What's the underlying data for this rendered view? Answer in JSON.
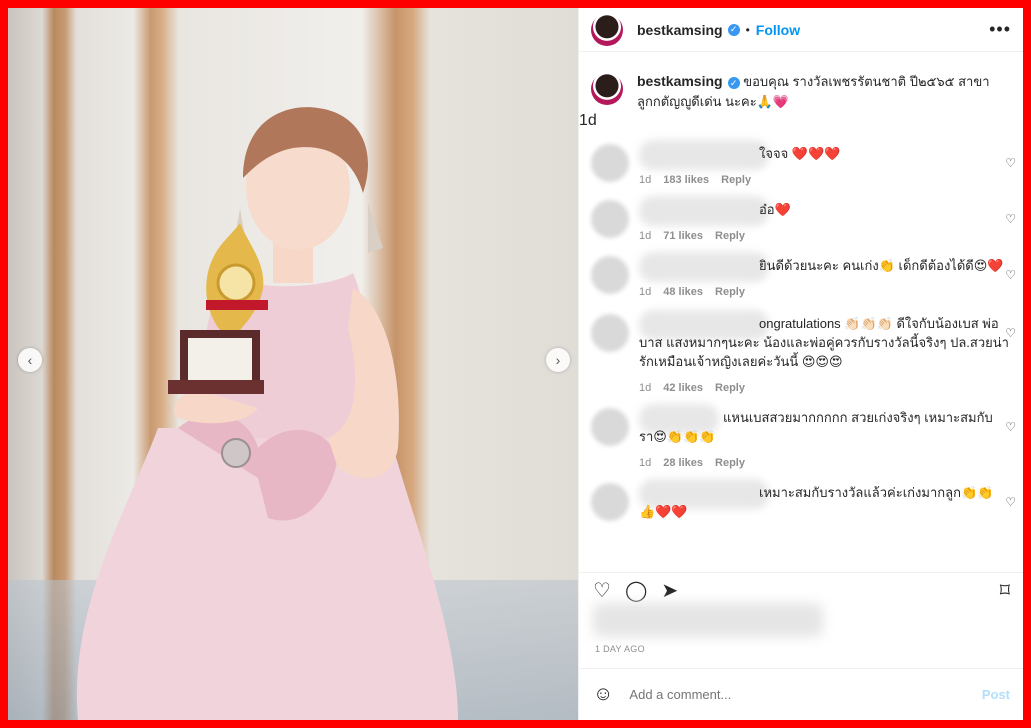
{
  "post": {
    "username": "bestkamsing",
    "verified_mark": "✓",
    "separator": "•",
    "follow_label": "Follow",
    "more_label": "•••",
    "caption": "ขอบคุณ รางวัลเพชรรัตนชาติ ปี๒๕๖๕ สาขาลูกกตัญญูดีเด่น นะคะ🙏💗",
    "caption_time": "1d",
    "posted_ago": "1 DAY AGO"
  },
  "carousel": {
    "prev_label": "‹",
    "next_label": "›"
  },
  "comments": [
    {
      "text": "ใจจจ ❤️❤️❤️",
      "time": "1d",
      "likes": "183 likes",
      "reply": "Reply"
    },
    {
      "text": "อ๋อ❤️",
      "time": "1d",
      "likes": "71 likes",
      "reply": "Reply"
    },
    {
      "text": "ยินดีด้วยนะคะ คนเก่ง👏 เด็กดีต้องได้ดี😍❤️",
      "time": "1d",
      "likes": "48 likes",
      "reply": "Reply"
    },
    {
      "text": "ongratulations 👏🏻👏🏻👏🏻 ดีใจกับน้องเบส พ่อบาส แสงหมากๆนะคะ น้องและพ่อคู่ควรกับรางวัลนี้จริงๆ ปล.สวยน่ารักเหมือนเจ้าหญิงเลยค่ะวันนี้ 😍😍😍",
      "time": "1d",
      "likes": "42 likes",
      "reply": "Reply"
    },
    {
      "text": "แหนเบสสวยมากกกกก สวยเก่งจริงๆ เหมาะสมกับ รา😍👏👏👏",
      "time": "1d",
      "likes": "28 likes",
      "reply": "Reply"
    },
    {
      "text": "เหมาะสมกับรางวัลแล้วค่ะเก่งมากลูก👏👏👍❤️❤️",
      "time": "",
      "likes": "",
      "reply": ""
    }
  ],
  "icons": {
    "heart": "♡",
    "comment": "◯",
    "share": "➤",
    "save": "⌑",
    "emoji": "☺"
  },
  "composer": {
    "placeholder": "Add a comment...",
    "post_label": "Post"
  },
  "colors": {
    "frame": "#ff0000",
    "link": "#0095f6",
    "post_disabled": "#b2dffc"
  }
}
